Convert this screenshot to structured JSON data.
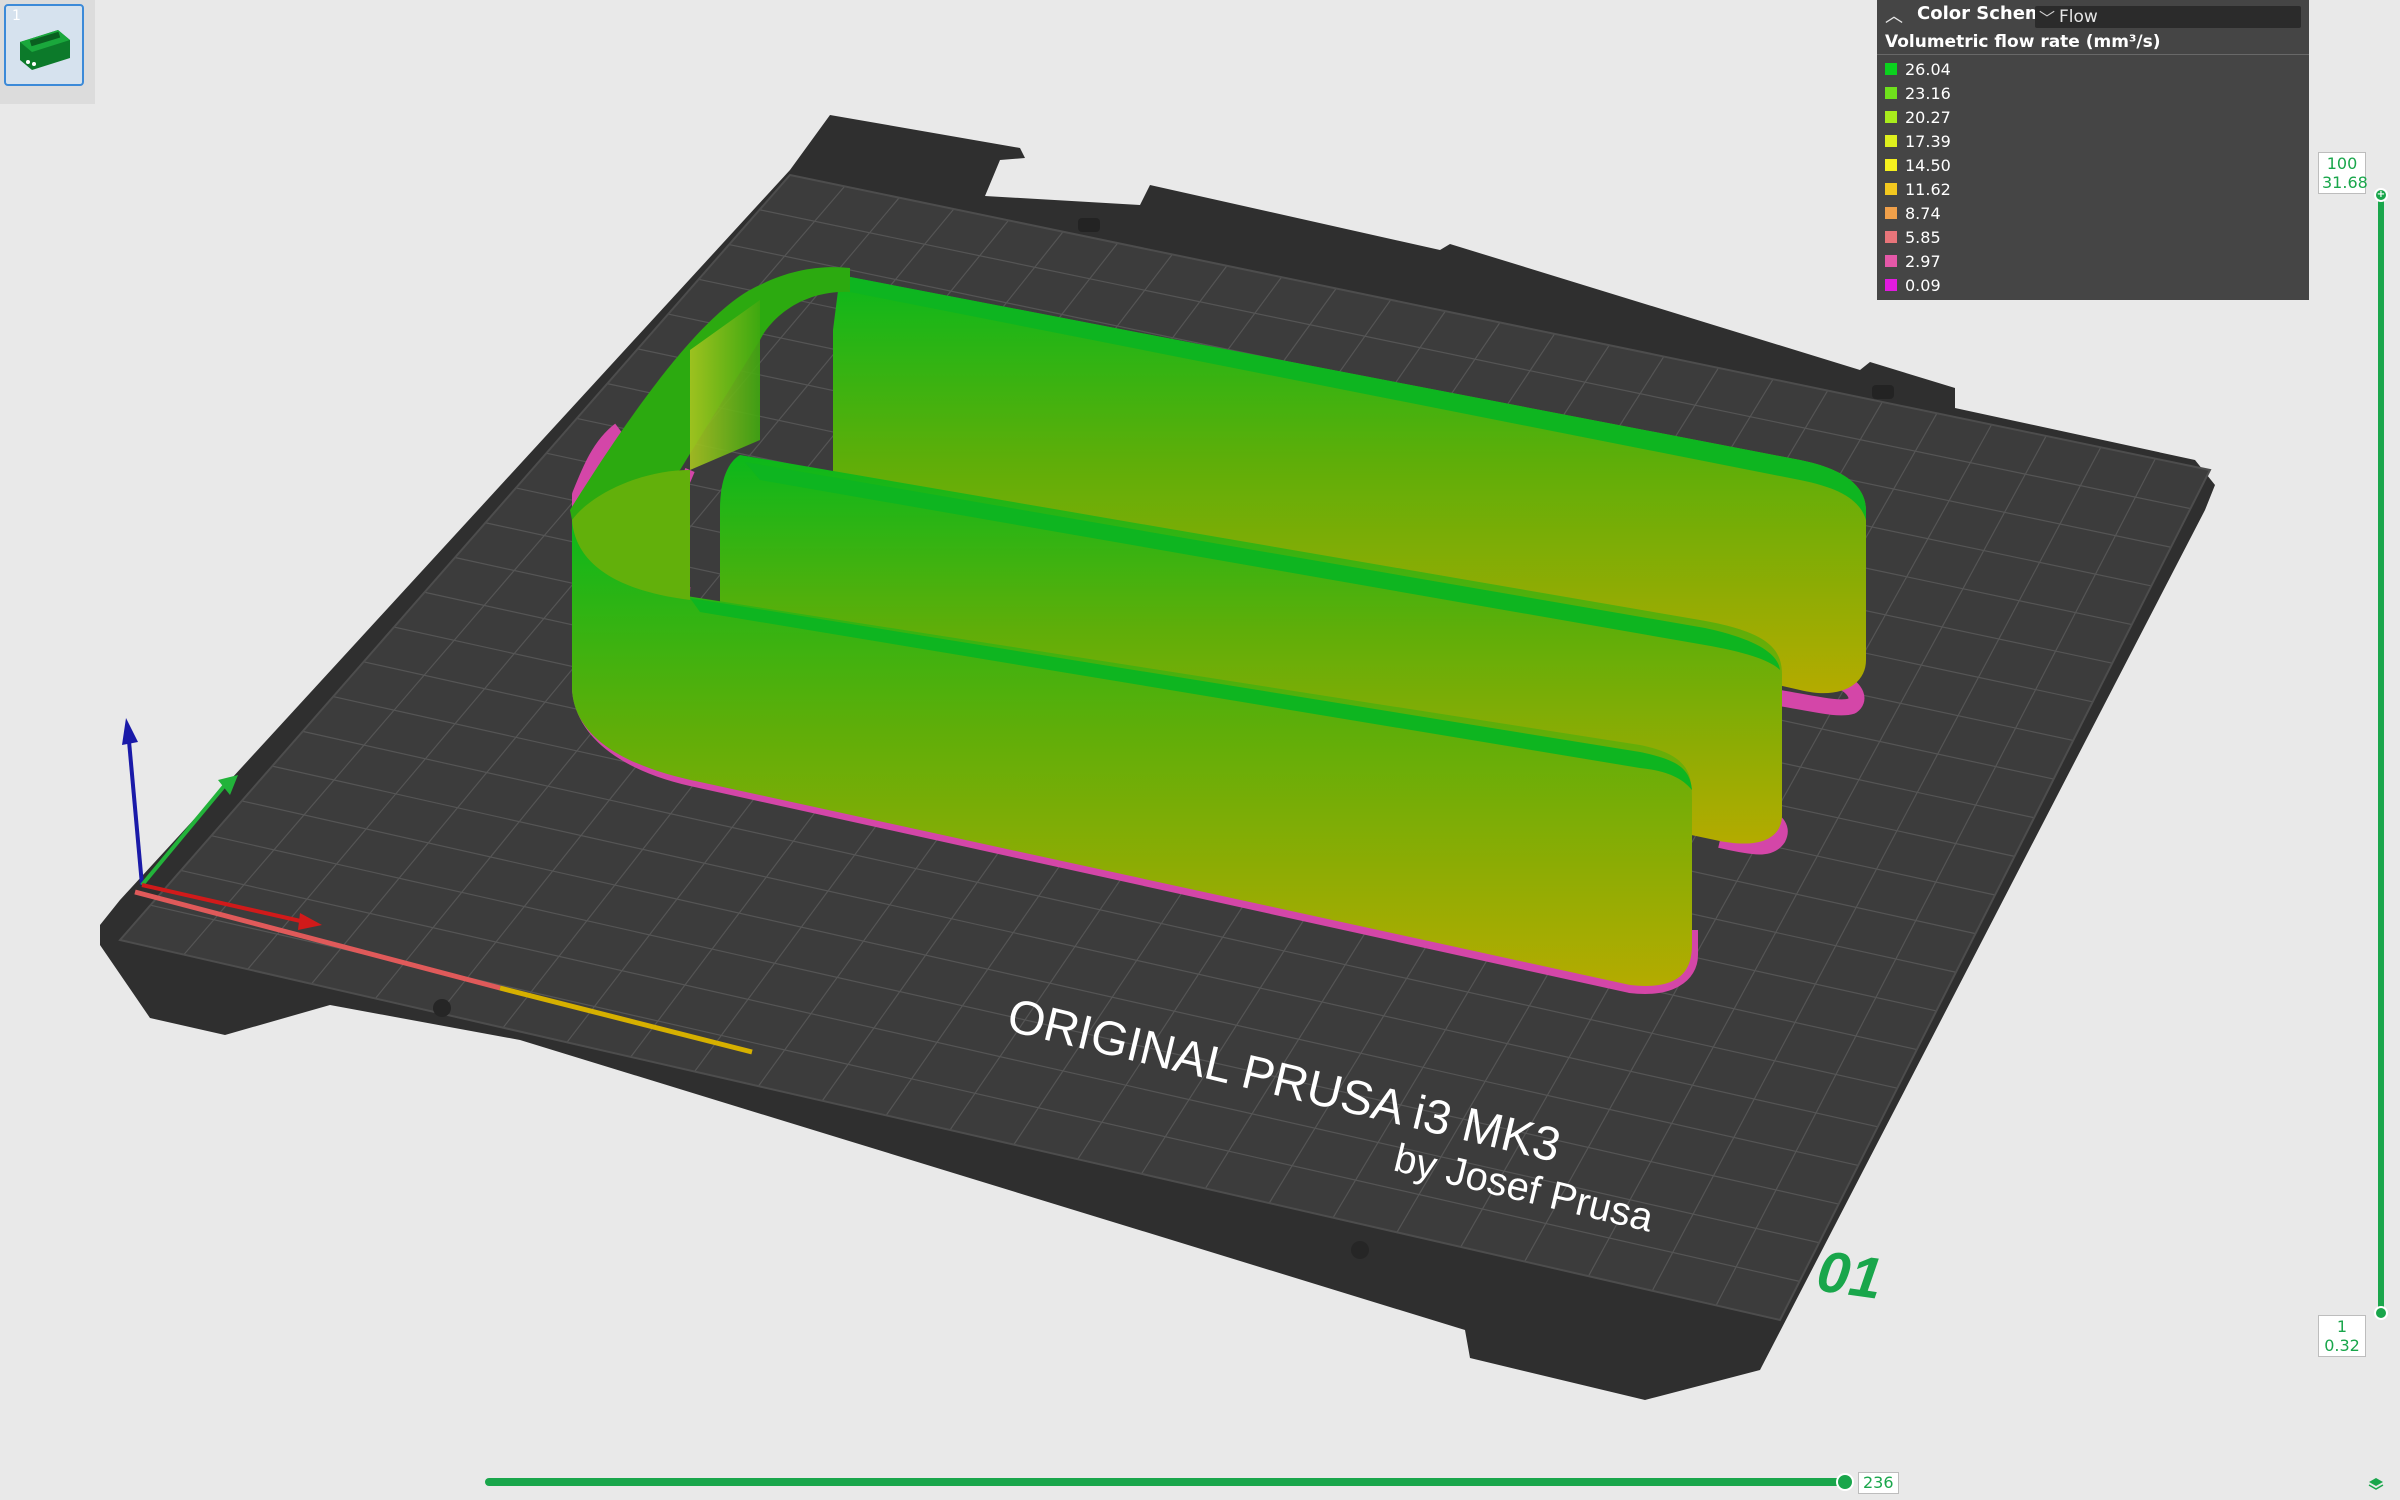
{
  "colors": {
    "bed_dark": "#3c3c3c",
    "bed_grid": "#5a5a5a",
    "accent_green": "#19a64b",
    "axis_x": "#d11a1a",
    "axis_y": "#22b33a",
    "axis_z": "#1a1aa8"
  },
  "thumbnail": {
    "index": "1"
  },
  "legend": {
    "header_label": "Color Scheme",
    "selected_scheme": "Flow",
    "title": "Volumetric flow rate (mm³/s)",
    "items": [
      {
        "value": "26.04",
        "color": "#0bd11e"
      },
      {
        "value": "23.16",
        "color": "#6fe11c"
      },
      {
        "value": "20.27",
        "color": "#a9ec1c"
      },
      {
        "value": "17.39",
        "color": "#dff01d"
      },
      {
        "value": "14.50",
        "color": "#f5f01e"
      },
      {
        "value": "11.62",
        "color": "#f3c81f"
      },
      {
        "value": "8.74",
        "color": "#f0a04a"
      },
      {
        "value": "5.85",
        "color": "#e8757a"
      },
      {
        "value": "2.97",
        "color": "#e558a8"
      },
      {
        "value": "0.09",
        "color": "#e21ae0"
      }
    ]
  },
  "bed": {
    "label_line1": "ORIGINAL PRUSA i3  MK3",
    "label_line2": "by Josef Prusa",
    "sheet_number": "01"
  },
  "layer_slider": {
    "top_layer": "100",
    "top_height": "31.68",
    "bottom_layer": "1",
    "bottom_height": "0.32"
  },
  "move_slider": {
    "value": "236"
  }
}
